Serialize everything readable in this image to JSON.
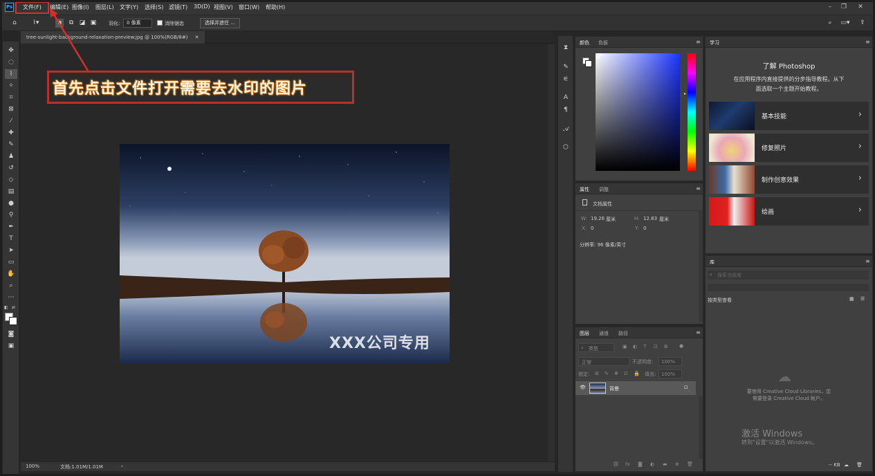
{
  "menu": {
    "items": [
      "文件(F)",
      "编辑(E)",
      "图像(I)",
      "图层(L)",
      "文字(Y)",
      "选择(S)",
      "滤镜(T)",
      "3D(D)",
      "视图(V)",
      "窗口(W)",
      "帮助(H)"
    ]
  },
  "options": {
    "feather_label": "羽化:",
    "feather_value": "0 像素",
    "antialias_label": "消除锯齿",
    "select_mask_button": "选择并遮住 ..."
  },
  "document": {
    "tab_title": "tree-sunlight-background-relaxation-preview.jpg @ 100%(RGB/8#)",
    "zoom": "100%",
    "doc_info": "文档:1.01M/1.01M",
    "watermark": "XXX公司专用"
  },
  "annotation": {
    "text": "首先点击文件打开需要去水印的图片"
  },
  "color_panel": {
    "tabs": [
      "颜色",
      "色板"
    ]
  },
  "properties_panel": {
    "tabs": [
      "属性",
      "调整"
    ],
    "section": "文档属性",
    "w_label": "W:",
    "w_value": "19.26",
    "w_unit": "厘米",
    "h_label": "H:",
    "h_value": "12.83",
    "h_unit": "厘米",
    "x_label": "X:",
    "x_value": "0",
    "y_label": "Y:",
    "y_value": "0",
    "resolution": "分辨率: 96 像素/英寸"
  },
  "layers_panel": {
    "tabs": [
      "图层",
      "通道",
      "路径"
    ],
    "filter_label": "类型",
    "blend_mode": "正常",
    "opacity_label": "不透明度:",
    "opacity_value": "100%",
    "lock_label": "锁定:",
    "fill_label": "填充:",
    "fill_value": "100%",
    "layer_name": "背景"
  },
  "learn_panel": {
    "tab": "学习",
    "title": "了解 Photoshop",
    "desc_line1": "在应用程序内直接提供的分步指导教程。从下",
    "desc_line2": "面选取一个主题开始教程。",
    "cards": [
      {
        "label": "基本技能"
      },
      {
        "label": "修复照片"
      },
      {
        "label": "制作创意效果"
      },
      {
        "label": "绘画"
      }
    ]
  },
  "library_panel": {
    "tab": "库",
    "search_placeholder": "搜索当前库",
    "view_by": "按类型查看",
    "cc_line1": "要使用 Creative Cloud Libraries，您",
    "cc_line2": "需要登录 Creative Cloud 帐户。",
    "size": "-- KB"
  },
  "windows_watermark": {
    "line1": "激活 Windows",
    "line2": "转到\"设置\"以激活 Windows。"
  },
  "colors": {
    "accent_red": "#d3302b",
    "ps_blue": "#31a8ff"
  }
}
